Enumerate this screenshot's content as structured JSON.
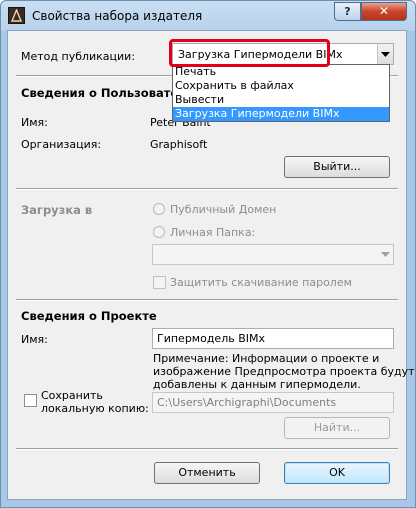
{
  "window": {
    "title": "Свойства набора издателя",
    "help_label": "?",
    "close_label": "✕"
  },
  "publish": {
    "method_label": "Метод публикации:",
    "selected": "Загрузка Гипермодели BIMx",
    "options": [
      "Печать",
      "Сохранить в файлах",
      "Вывести",
      "Загрузка Гипермодели BIMx"
    ]
  },
  "user": {
    "section_title": "Сведения о Пользователе",
    "name_label": "Имя:",
    "name_value": "Peter Baint",
    "org_label": "Организация:",
    "org_value": "Graphisoft",
    "logout_label": "Выйти..."
  },
  "upload": {
    "label": "Загрузка в",
    "public_domain": "Публичный Домен",
    "personal_folder": "Личная Папка:",
    "protect_label": "Защитить скачивание паролем"
  },
  "project": {
    "section_title": "Сведения о Проекте",
    "name_label": "Имя:",
    "name_value": "Гипермодель BIMx",
    "note": [
      "Примечание: Информации о проекте и",
      "изображение Предпросмотра проекта будут",
      "добавлены к данным гипермодели."
    ],
    "save_local_label": [
      "Сохранить",
      "локальную копию:"
    ],
    "path_value": "C:\\Users\\Archigraphi\\Documents",
    "find_label": "Найти..."
  },
  "footer": {
    "cancel_label": "Отменить",
    "ok_label": "OK"
  },
  "colors": {
    "highlight": "#e0001b",
    "selection": "#3399ff"
  }
}
